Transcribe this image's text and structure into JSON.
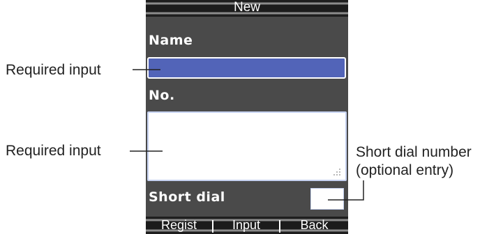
{
  "screen": {
    "title": "New",
    "name_label": "Name",
    "number_label": "No.",
    "short_dial_label": "Short dial",
    "name_value": "",
    "number_value": "",
    "short_dial_value": ""
  },
  "softkeys": {
    "left": "Regist",
    "center": "Input",
    "right": "Back"
  },
  "annotations": {
    "name_required": "Required input",
    "number_required": "Required input",
    "short_dial_line1": "Short dial number",
    "short_dial_line2": "(optional entry)"
  },
  "colors": {
    "screen_background": "#4a4a4a",
    "selected_field": "#5264b8",
    "input_border": "#c5d1f0",
    "text_on_screen": "#ffffff"
  }
}
